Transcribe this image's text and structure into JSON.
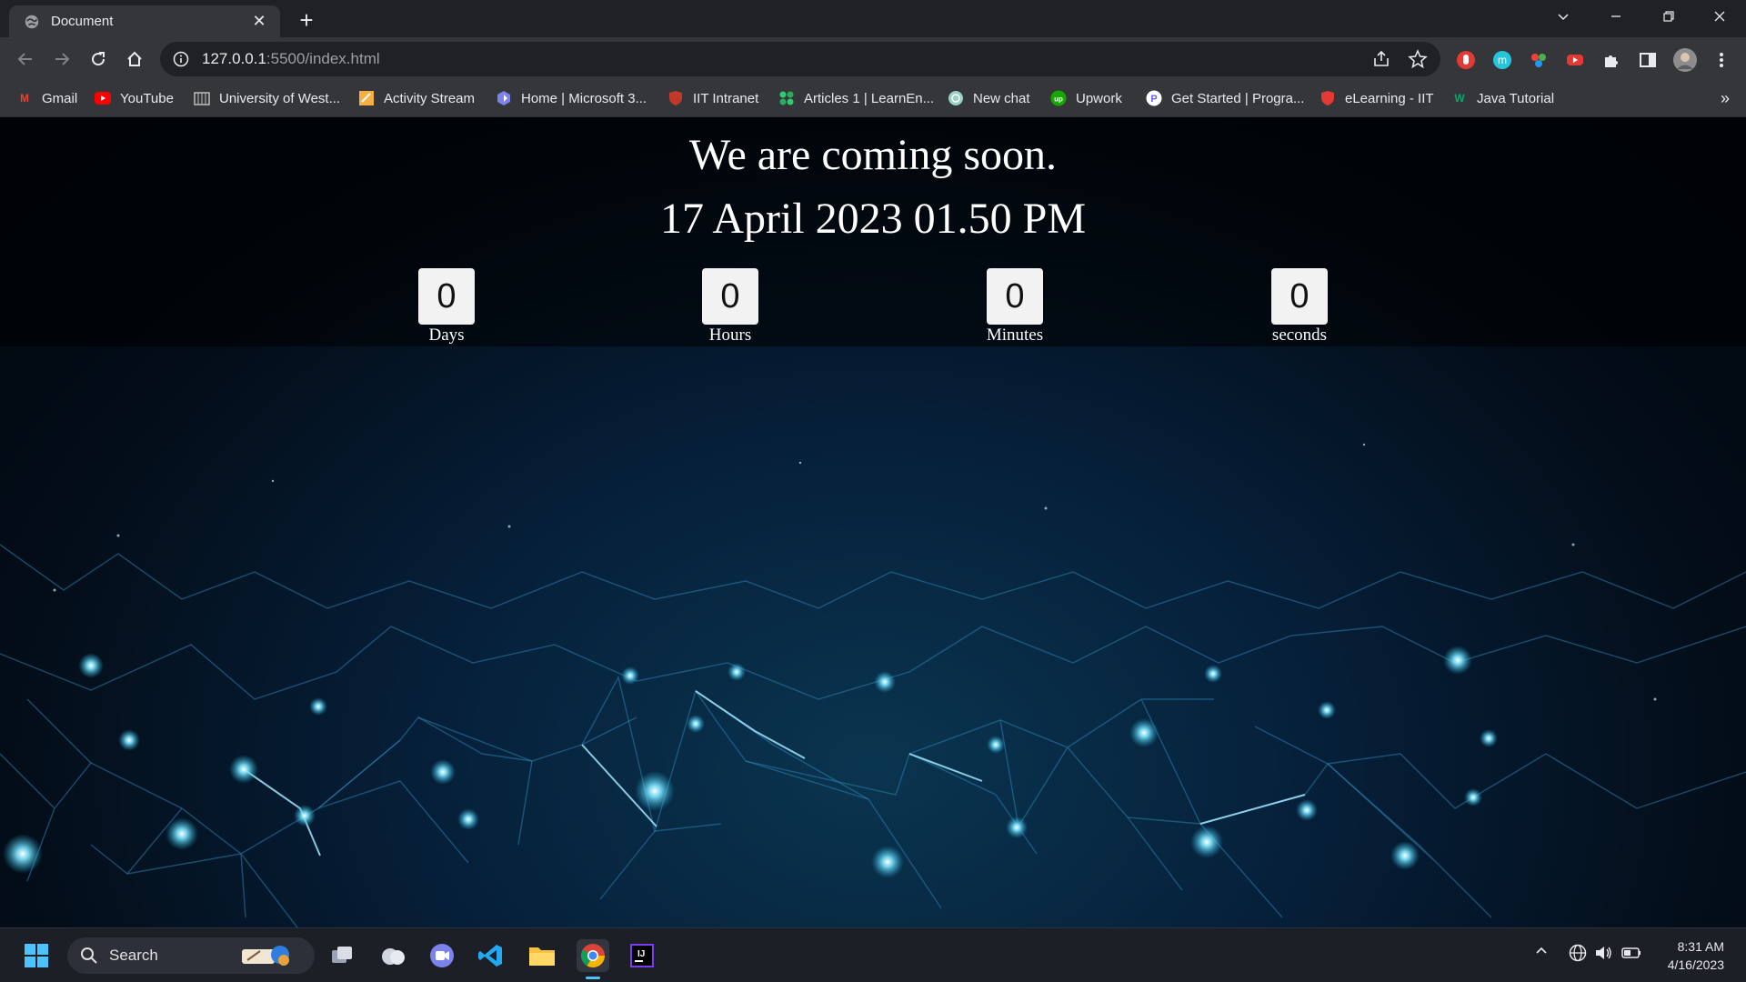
{
  "browser": {
    "tab": {
      "title": "Document"
    },
    "url": {
      "host": "127.0.0.1",
      "rest": ":5500/index.html"
    }
  },
  "bookmarks": [
    {
      "label": "Gmail",
      "icon": "gmail-icon",
      "color": "#ea4335"
    },
    {
      "label": "YouTube",
      "icon": "youtube-icon",
      "color": "#ff0000"
    },
    {
      "label": "University of West...",
      "icon": "university-icon",
      "color": "#bdbdbd"
    },
    {
      "label": "Activity Stream",
      "icon": "activity-icon",
      "color": "#f5b041"
    },
    {
      "label": "Home | Microsoft 3...",
      "icon": "microsoft-icon",
      "color": "#7b83eb"
    },
    {
      "label": "IIT Intranet",
      "icon": "shield-icon",
      "color": "#c0392b"
    },
    {
      "label": "Articles 1 | LearnEn...",
      "icon": "articles-icon",
      "color": "#2ecc71"
    },
    {
      "label": "New chat",
      "icon": "chatgpt-icon",
      "color": "#9ad1c3"
    },
    {
      "label": "Upwork",
      "icon": "upwork-icon",
      "color": "#14a800"
    },
    {
      "label": "Get Started | Progra...",
      "icon": "programiz-icon",
      "color": "#6c5ce7"
    },
    {
      "label": "eLearning - IIT",
      "icon": "shield-icon",
      "color": "#e53935"
    },
    {
      "label": "Java Tutorial",
      "icon": "w3schools-icon",
      "color": "#04aa6d"
    }
  ],
  "page": {
    "title": "We are coming soon.",
    "date": "17 April 2023 01.50 PM",
    "countdown": [
      {
        "value": "0",
        "label": "Days"
      },
      {
        "value": "0",
        "label": "Hours"
      },
      {
        "value": "0",
        "label": "Minutes"
      },
      {
        "value": "0",
        "label": "seconds"
      }
    ]
  },
  "taskbar": {
    "search_label": "Search",
    "time": "8:31 AM",
    "date": "4/16/2023"
  }
}
